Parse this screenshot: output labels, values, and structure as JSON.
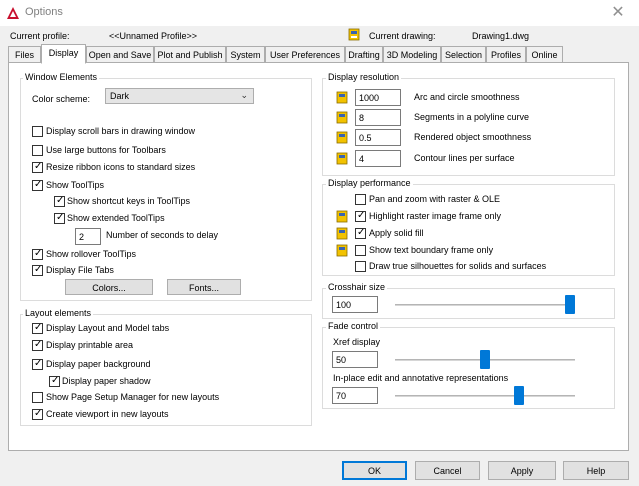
{
  "window": {
    "title": "Options",
    "close_glyph": "✕"
  },
  "header": {
    "current_profile_label": "Current profile:",
    "current_profile_value": "<<Unnamed Profile>>",
    "current_drawing_label": "Current drawing:",
    "current_drawing_value": "Drawing1.dwg"
  },
  "tabs": [
    "Files",
    "Display",
    "Open and Save",
    "Plot and Publish",
    "System",
    "User Preferences",
    "Drafting",
    "3D Modeling",
    "Selection",
    "Profiles",
    "Online"
  ],
  "active_tab": "Display",
  "window_elements": {
    "title": "Window Elements",
    "color_scheme_label": "Color scheme:",
    "color_scheme_value": "Dark",
    "options": [
      {
        "label": "Display scroll bars in drawing window",
        "checked": false
      },
      {
        "label": "Use large buttons for Toolbars",
        "checked": false
      },
      {
        "label": "Resize ribbon icons to standard sizes",
        "checked": true
      },
      {
        "label": "Show ToolTips",
        "checked": true
      },
      {
        "label": "Show shortcut keys in ToolTips",
        "checked": true
      },
      {
        "label": "Show extended ToolTips",
        "checked": true
      },
      {
        "label": "Show rollover ToolTips",
        "checked": true
      },
      {
        "label": "Display File Tabs",
        "checked": true
      }
    ],
    "delay_value": "2",
    "delay_label": "Number of seconds to delay",
    "colors_button": "Colors...",
    "fonts_button": "Fonts..."
  },
  "layout_elements": {
    "title": "Layout elements",
    "options": [
      {
        "label": "Display Layout and Model tabs",
        "checked": true
      },
      {
        "label": "Display printable area",
        "checked": true
      },
      {
        "label": "Display paper background",
        "checked": true
      },
      {
        "label": "Display paper shadow",
        "checked": true
      },
      {
        "label": "Show Page Setup Manager for new layouts",
        "checked": false
      },
      {
        "label": "Create viewport in new layouts",
        "checked": true
      }
    ]
  },
  "display_resolution": {
    "title": "Display resolution",
    "rows": [
      {
        "value": "1000",
        "label": "Arc and circle smoothness"
      },
      {
        "value": "8",
        "label": "Segments in a polyline curve"
      },
      {
        "value": "0.5",
        "label": "Rendered object smoothness"
      },
      {
        "value": "4",
        "label": "Contour lines per surface"
      }
    ]
  },
  "display_performance": {
    "title": "Display performance",
    "options": [
      {
        "label": "Pan and zoom with raster & OLE",
        "checked": false
      },
      {
        "label": "Highlight raster image frame only",
        "checked": true
      },
      {
        "label": "Apply solid fill",
        "checked": true
      },
      {
        "label": "Show text boundary frame only",
        "checked": false
      },
      {
        "label": "Draw true silhouettes for solids and surfaces",
        "checked": false
      }
    ]
  },
  "crosshair": {
    "title": "Crosshair size",
    "value": "100",
    "level_fraction": 1.0
  },
  "fade_control": {
    "title": "Fade control",
    "xref_label": "Xref display",
    "xref_value": "50",
    "xref_fraction": 0.5,
    "inplace_label": "In-place edit and annotative representations",
    "inplace_value": "70",
    "inplace_fraction": 0.7
  },
  "buttons": {
    "ok": "OK",
    "cancel": "Cancel",
    "apply": "Apply",
    "help": "Help"
  },
  "colors": {
    "accent": "#0078d7",
    "app_red": "#c8102e",
    "icon_yellow": "#f2c200"
  },
  "icons": {
    "app": "autocad-a-icon",
    "drawing": "drawing-saved-icon"
  },
  "check_glyph": "✓"
}
